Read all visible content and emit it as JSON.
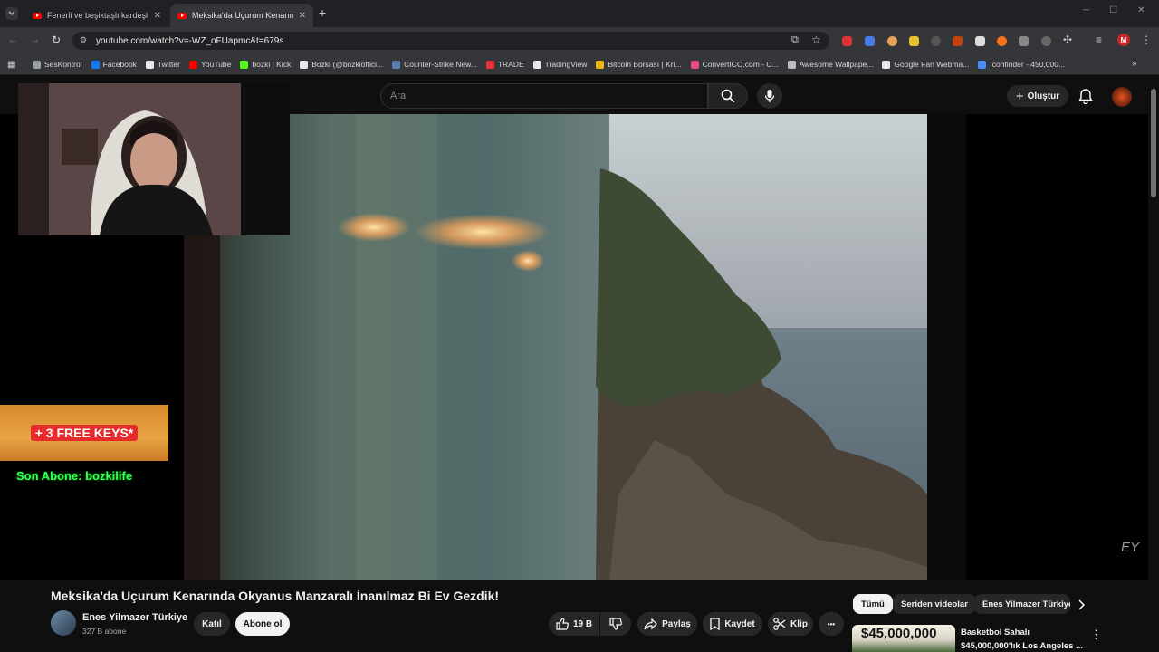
{
  "tabs": [
    {
      "title": "Fenerli ve beşiktaşlı kardeşlerin",
      "close": "✕"
    },
    {
      "title": "Meksika'da Uçurum Kenarında",
      "close": "✕"
    }
  ],
  "new_tab": "+",
  "url": "youtube.com/watch?v=-WZ_oFUapmc&t=679s",
  "bookmarks": [
    {
      "label": "SesKontrol",
      "color": "#9aa0a6"
    },
    {
      "label": "Facebook",
      "color": "#1877f2"
    },
    {
      "label": "Twitter",
      "color": "#e8e8e8"
    },
    {
      "label": "YouTube",
      "color": "#ff0000"
    },
    {
      "label": "bozki | Kick",
      "color": "#53fc18"
    },
    {
      "label": "Bozki (@bozkioffici...",
      "color": "#e8e8e8"
    },
    {
      "label": "Counter-Strike New...",
      "color": "#5b7fb5"
    },
    {
      "label": "TRADE",
      "color": "#e8333a"
    },
    {
      "label": "TradingView",
      "color": "#e8e8e8"
    },
    {
      "label": "Bitcoin Borsası | Kri...",
      "color": "#f0b90b"
    },
    {
      "label": "ConvertICO.com - C...",
      "color": "#e84a7f"
    },
    {
      "label": "Awesome Wallpape...",
      "color": "#bdbdbd"
    },
    {
      "label": "Google Fan Webma...",
      "color": "#e8e8e8"
    },
    {
      "label": "Iconfinder - 450,000...",
      "color": "#4a8bf5"
    }
  ],
  "search": {
    "placeholder": "Ara"
  },
  "create_label": "Oluştur",
  "overlay": {
    "keys": "+ 3 FREE KEYS*",
    "last_sub": "Son Abone: bozkilife"
  },
  "video": {
    "title": "Meksika'da Uçurum Kenarında Okyanus Manzaralı İnanılmaz Bi Ev Gezdik!",
    "channel": "Enes Yilmazer Türkiye",
    "subscribers": "327 B abone",
    "join": "Katıl",
    "subscribe": "Abone ol",
    "likes": "19 B",
    "share": "Paylaş",
    "save": "Kaydet",
    "clip": "Klip",
    "more": "•••",
    "watermark": "EY"
  },
  "chips": [
    "Tümü",
    "Seriden videolar",
    "Enes Yilmazer Türkiye"
  ],
  "recommended": {
    "price": "$45,000,000",
    "title": "Basketbol Sahalı",
    "subtitle": "$45,000,000'lık Los Angeles ..."
  }
}
